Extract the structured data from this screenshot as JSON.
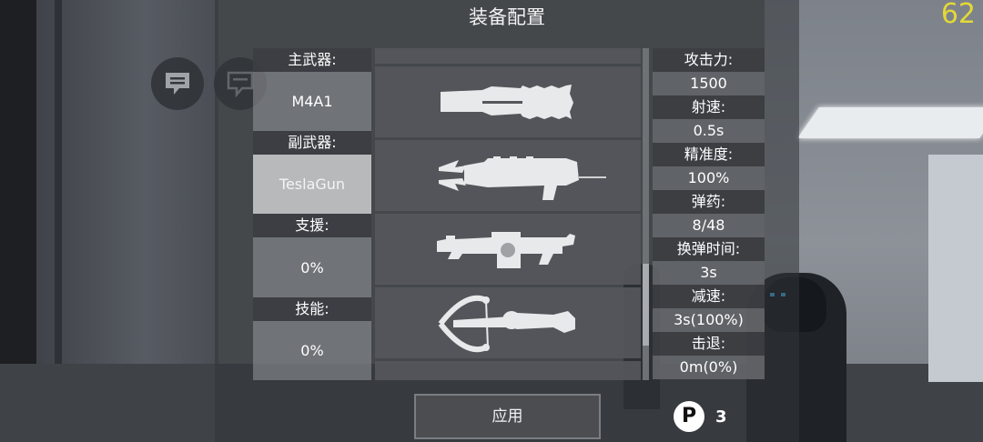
{
  "hud": {
    "fps": "62",
    "chat_icons": [
      "chat-bubble-icon",
      "voice-chat-icon"
    ]
  },
  "dialog": {
    "title": "装备配置",
    "apply_label": "应用",
    "points_icon": "P",
    "points_value": "3"
  },
  "loadout": {
    "primary_label": "主武器:",
    "primary_value": "M4A1",
    "secondary_label": "副武器:",
    "secondary_value": "TeslaGun",
    "support_label": "支援:",
    "support_value": "0%",
    "skill_label": "技能:",
    "skill_value": "0%"
  },
  "weapons": [
    "tesla-rifle-icon",
    "claw-cannon-icon",
    "grenade-launcher-icon",
    "crossbow-icon"
  ],
  "stats": [
    {
      "label": "攻击力:",
      "value": "1500"
    },
    {
      "label": "射速:",
      "value": "0.5s"
    },
    {
      "label": "精准度:",
      "value": "100%"
    },
    {
      "label": "弹药:",
      "value": "8/48"
    },
    {
      "label": "换弹时间:",
      "value": "3s"
    },
    {
      "label": "减速:",
      "value": "3s(100%)"
    },
    {
      "label": "击退:",
      "value": "0m(0%)"
    }
  ]
}
